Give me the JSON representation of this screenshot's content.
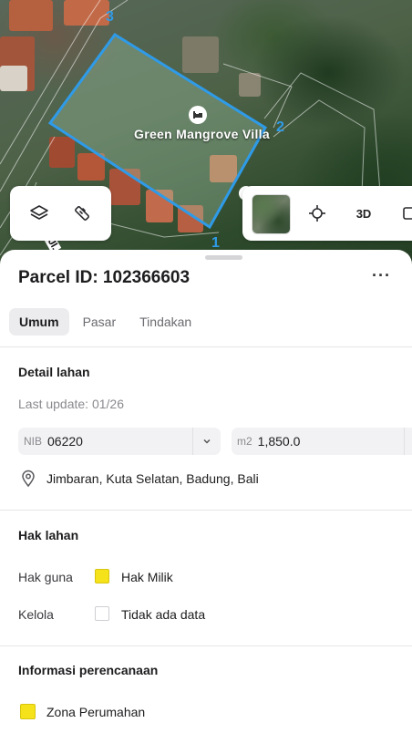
{
  "map": {
    "place_label": "Green Mangrove Villa",
    "vertex_labels": [
      "1",
      "2",
      "3"
    ],
    "road_label": "Jl. ",
    "colors": {
      "parcel_outline": "#2f9be8",
      "parcel_fill": "rgba(160,200,170,0.35)"
    },
    "icons": {
      "poi": "hotel-icon",
      "layers": "layers-icon",
      "measure": "ruler-icon",
      "locate": "crosshair-icon",
      "extra": "rotate-icon"
    },
    "controls": {
      "three_d_label": "3D"
    }
  },
  "sheet": {
    "title": "Parcel ID: 102366603",
    "more_label": "···",
    "tabs": [
      {
        "label": "Umum",
        "active": true
      },
      {
        "label": "Pasar",
        "active": false
      },
      {
        "label": "Tindakan",
        "active": false
      }
    ],
    "detail": {
      "heading": "Detail lahan",
      "last_update": "Last update: 01/26",
      "nib_prefix": "NIB",
      "nib_value": "06220",
      "area_prefix": "m2",
      "area_value": "1,850.0",
      "address": "Jimbaran, Kuta Selatan, Badung, Bali"
    },
    "rights": {
      "heading": "Hak lahan",
      "rows": [
        {
          "label": "Hak guna",
          "value": "Hak Milik",
          "swatch": "#f5e21a"
        },
        {
          "label": "Kelola",
          "value": "Tidak ada data",
          "swatch": "#ffffff"
        }
      ]
    },
    "planning": {
      "heading": "Informasi perencanaan",
      "zone": "Zona Perumahan",
      "zone_color": "#f5e21a"
    }
  }
}
